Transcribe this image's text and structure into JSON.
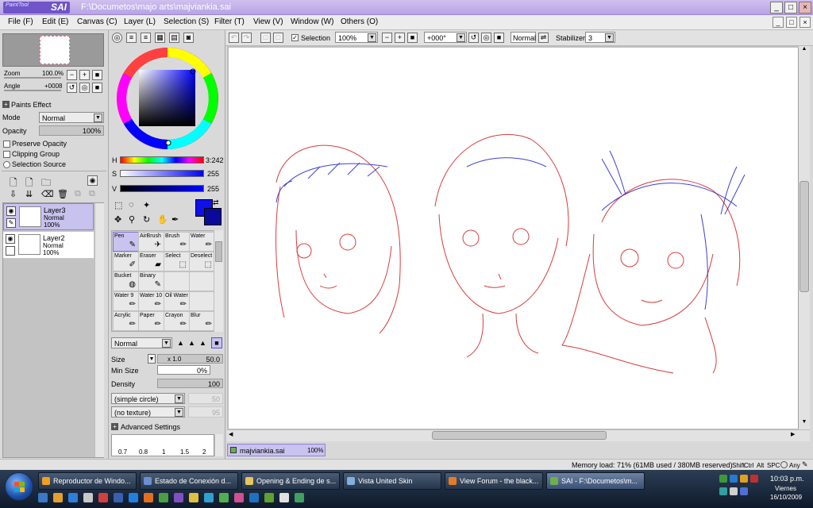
{
  "window": {
    "logo_small": "PaintTool",
    "logo_big": "SAI",
    "title": "F:\\Documetos\\majo arts\\majviankia.sai",
    "controls": [
      "_",
      "□",
      "×"
    ],
    "mdi_controls": [
      "_",
      "□",
      "×"
    ]
  },
  "menu": [
    "File (F)",
    "Edit (E)",
    "Canvas (C)",
    "Layer (L)",
    "Selection (S)",
    "Filter (T)",
    "View (V)",
    "Window (W)",
    "Others (O)"
  ],
  "navigator": {
    "zoom_label": "Zoom",
    "zoom_value": "100.0%",
    "angle_label": "Angle",
    "angle_value": "+0008"
  },
  "layer_props": {
    "paints_effect": "Paints Effect",
    "mode_label": "Mode",
    "mode_value": "Normal",
    "opacity_label": "Opacity",
    "opacity_value": "100%",
    "preserve_opacity": "Preserve Opacity",
    "clipping_group": "Clipping Group",
    "selection_source": "Selection Source"
  },
  "layers": [
    {
      "name": "Layer3",
      "mode": "Normal",
      "opacity": "100%",
      "selected": true
    },
    {
      "name": "Layer2",
      "mode": "Normal",
      "opacity": "100%",
      "selected": false
    }
  ],
  "color": {
    "h_label": "H",
    "h_value": "3:242",
    "s_label": "S",
    "s_value": "255",
    "v_label": "V",
    "v_value": "255",
    "main_color": "#1010e8",
    "sub_color": "#0a0a9a"
  },
  "tools": [
    {
      "label": "Pen",
      "icon": "pen-icon",
      "selected": true
    },
    {
      "label": "AirBrush",
      "icon": "airbrush-icon"
    },
    {
      "label": "Brush",
      "icon": "brush-icon"
    },
    {
      "label": "Water",
      "icon": "water-icon"
    },
    {
      "label": "Marker",
      "icon": "marker-icon"
    },
    {
      "label": "Eraser",
      "icon": "eraser-icon"
    },
    {
      "label": "Select",
      "icon": "select-icon"
    },
    {
      "label": "Deselect",
      "icon": "deselect-icon"
    },
    {
      "label": "Bucket",
      "icon": "bucket-icon"
    },
    {
      "label": "Binary",
      "icon": "binary-icon"
    },
    {
      "label": "",
      "icon": ""
    },
    {
      "label": "",
      "icon": ""
    },
    {
      "label": "Water 9",
      "icon": "water-9-icon"
    },
    {
      "label": "Water 10",
      "icon": "water-10-icon"
    },
    {
      "label": "Oil Water",
      "icon": "oil-water-icon"
    },
    {
      "label": "",
      "icon": ""
    },
    {
      "label": "Acrylic",
      "icon": "acrylic-icon"
    },
    {
      "label": "Paper",
      "icon": "paper-icon"
    },
    {
      "label": "Crayon",
      "icon": "crayon-icon"
    },
    {
      "label": "Blur",
      "icon": "blur-icon"
    }
  ],
  "brush": {
    "mode_value": "Normal",
    "size_label": "Size",
    "size_mult": "x 1.0",
    "size_value": "50.0",
    "min_size_label": "Min Size",
    "min_size_value": "0%",
    "density_label": "Density",
    "density_value": "100",
    "shape_value": "(simple circle)",
    "shape_amount": "50",
    "texture_value": "(no texture)",
    "texture_amount": "95",
    "advanced_settings": "Advanced Settings",
    "size_presets": [
      "0.7",
      "0.8",
      "1",
      "1.5",
      "2"
    ]
  },
  "toolbar": {
    "selection_label": "Selection",
    "zoom_value": "100%",
    "angle_value": "+000°",
    "blend_value": "Normal",
    "stabilizer_label": "Stabilizer",
    "stabilizer_value": "3"
  },
  "document_tab": {
    "name": "majviankia.sai",
    "zoom": "100%"
  },
  "status": {
    "memory": "Memory load: 71% (61MB used / 380MB reserved)",
    "keys": [
      "Shift",
      "Ctrl",
      "Alt",
      "SPC",
      "Any"
    ]
  },
  "taskbar": {
    "buttons": [
      {
        "label": "Reproductor de Windo...",
        "color": "#f0a020"
      },
      {
        "label": "Estado de Conexión d...",
        "color": "#6b8fd0"
      },
      {
        "label": "Opening & Ending de s...",
        "color": "#e8c560"
      },
      {
        "label": "Vista United Skin",
        "color": "#7fb0e0"
      },
      {
        "label": "View Forum - the black...",
        "color": "#e57b2a"
      },
      {
        "label": "SAI - F:\\Documetos\\m...",
        "color": "#6ab04c",
        "active": true
      }
    ],
    "quicklaunch_colors": [
      "#3a78c8",
      "#e3a02a",
      "#2d7fd8",
      "#c8c8c8",
      "#d04040",
      "#3a5fb0",
      "#2080e0",
      "#e07020",
      "#4aa040",
      "#8050c0",
      "#e0c040",
      "#30a0d0",
      "#50b050",
      "#d05090",
      "#2070c0",
      "#60a030",
      "#e0e0e0",
      "#40a060"
    ],
    "tray_colors": [
      "#3a9a3a",
      "#2a78d0",
      "#e0a020",
      "#c03030",
      "#30a0a0",
      "#d0d0d0",
      "#5070d0"
    ],
    "time": "10:03 p.m.",
    "day": "Viernes",
    "date": "16/10/2009"
  }
}
